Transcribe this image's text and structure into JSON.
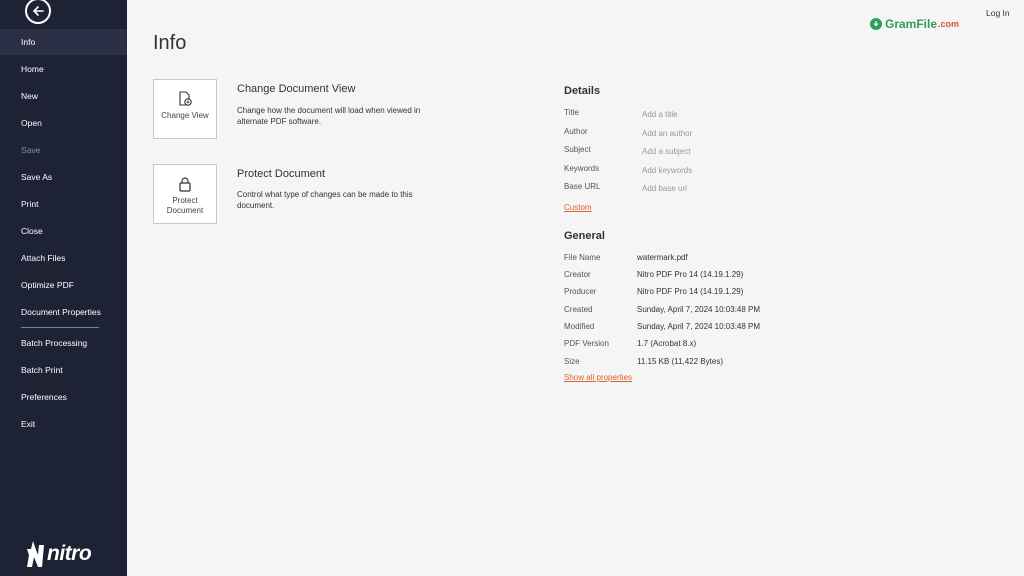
{
  "sidebar": {
    "items": [
      {
        "label": "Info"
      },
      {
        "label": "Home"
      },
      {
        "label": "New"
      },
      {
        "label": "Open"
      },
      {
        "label": "Save"
      },
      {
        "label": "Save As"
      },
      {
        "label": "Print"
      },
      {
        "label": "Close"
      },
      {
        "label": "Attach Files"
      },
      {
        "label": "Optimize PDF"
      },
      {
        "label": "Document Properties"
      },
      {
        "label": "Batch Processing"
      },
      {
        "label": "Batch Print"
      },
      {
        "label": "Preferences"
      },
      {
        "label": "Exit"
      }
    ],
    "logo": "nitro"
  },
  "header": {
    "title": "Info",
    "login": "Log In",
    "watermark": {
      "name": "GramFile",
      "suffix": ".com"
    }
  },
  "actions": [
    {
      "card_label": "Change View",
      "title": "Change Document View",
      "description": "Change how the document will load when viewed in alternate PDF software.",
      "icon": "change-view-icon"
    },
    {
      "card_label": "Protect Document",
      "title": "Protect Document",
      "description": "Control what type of changes can be made to this document.",
      "icon": "lock-icon"
    }
  ],
  "details": {
    "title": "Details",
    "fields": [
      {
        "label": "Title",
        "placeholder": "Add a title"
      },
      {
        "label": "Author",
        "placeholder": "Add an author"
      },
      {
        "label": "Subject",
        "placeholder": "Add a subject"
      },
      {
        "label": "Keywords",
        "placeholder": "Add keywords"
      },
      {
        "label": "Base URL",
        "placeholder": "Add base url"
      }
    ],
    "custom_link": "Custom"
  },
  "general": {
    "title": "General",
    "rows": [
      {
        "label": "File Name",
        "value": "watermark.pdf"
      },
      {
        "label": "Creator",
        "value": "Nitro PDF Pro 14 (14.19.1.29)"
      },
      {
        "label": "Producer",
        "value": "Nitro PDF Pro 14 (14.19.1.29)"
      },
      {
        "label": "Created",
        "value": "Sunday, April 7, 2024 10:03:48 PM"
      },
      {
        "label": "Modified",
        "value": "Sunday, April 7, 2024 10:03:48 PM"
      },
      {
        "label": "PDF Version",
        "value": "1.7 (Acrobat 8.x)"
      },
      {
        "label": "Size",
        "value": "11.15 KB (11,422 Bytes)"
      }
    ],
    "show_all_link": "Show all properties"
  },
  "colors": {
    "sidebar": "#1e2235",
    "accent": "#e06030",
    "watermark_green": "#2e9e5a"
  }
}
